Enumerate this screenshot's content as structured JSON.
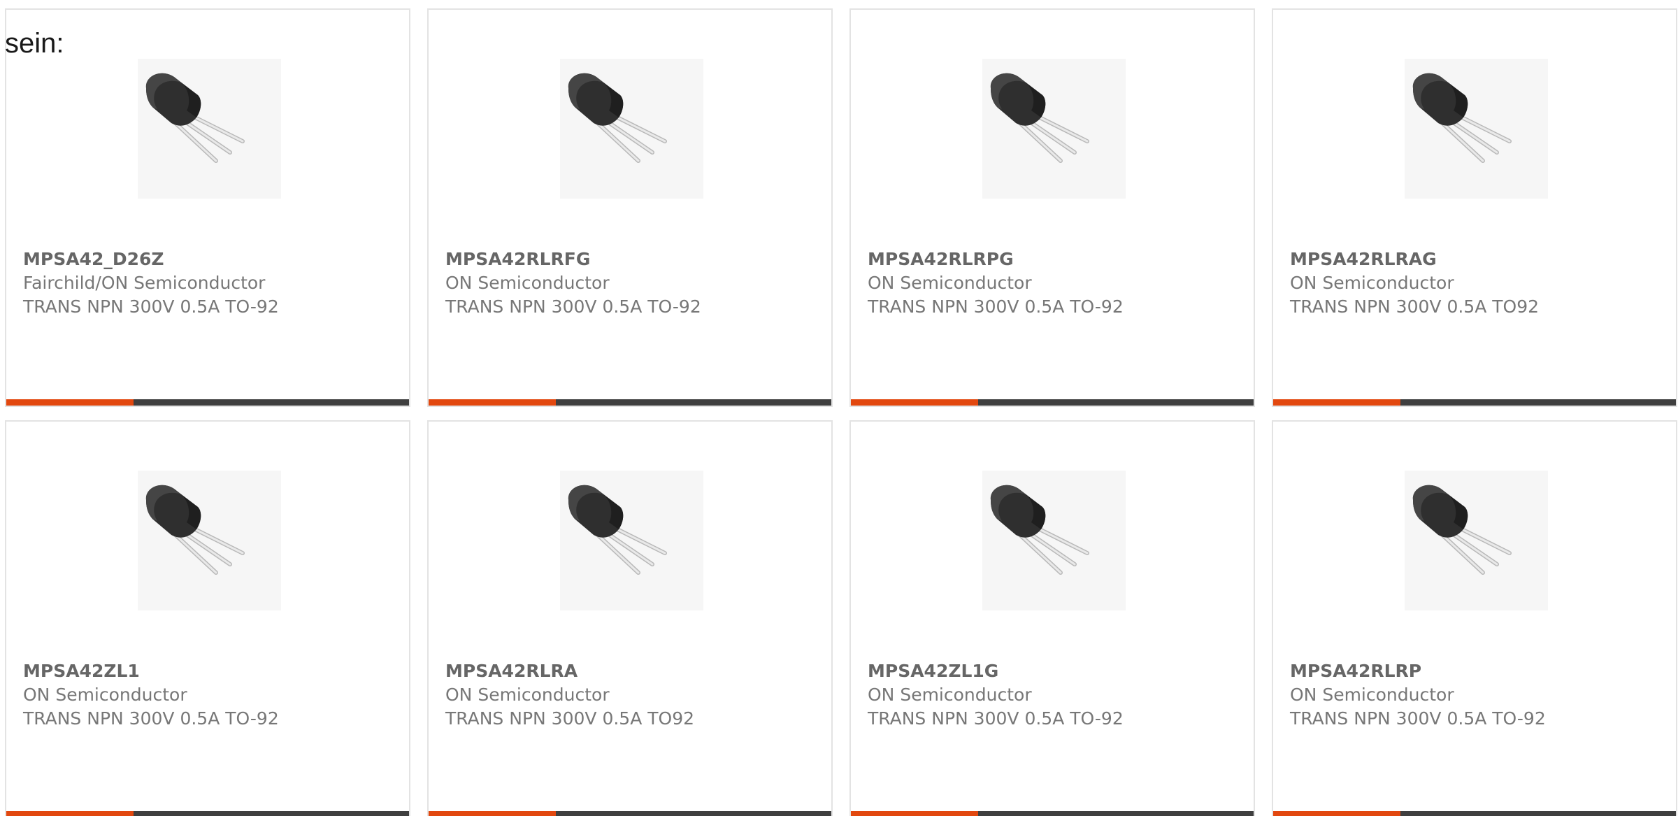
{
  "intro_text": "sein:",
  "colors": {
    "accent_orange": "#e2480f",
    "accent_dark": "#3f3f3f",
    "card_border": "#e3e3e3",
    "text": "#777777"
  },
  "products": [
    {
      "part_number": "MPSA42_D26Z",
      "manufacturer": "Fairchild/ON Semiconductor",
      "description": "TRANS NPN 300V 0.5A TO-92",
      "image_icon": "to92-transistor-icon"
    },
    {
      "part_number": "MPSA42RLRFG",
      "manufacturer": "ON Semiconductor",
      "description": "TRANS NPN 300V 0.5A TO-92",
      "image_icon": "to92-transistor-icon"
    },
    {
      "part_number": "MPSA42RLRPG",
      "manufacturer": "ON Semiconductor",
      "description": "TRANS NPN 300V 0.5A TO-92",
      "image_icon": "to92-transistor-icon"
    },
    {
      "part_number": "MPSA42RLRAG",
      "manufacturer": "ON Semiconductor",
      "description": "TRANS NPN 300V 0.5A TO92",
      "image_icon": "to92-transistor-icon"
    },
    {
      "part_number": "MPSA42ZL1",
      "manufacturer": "ON Semiconductor",
      "description": "TRANS NPN 300V 0.5A TO-92",
      "image_icon": "to92-transistor-icon"
    },
    {
      "part_number": "MPSA42RLRA",
      "manufacturer": "ON Semiconductor",
      "description": "TRANS NPN 300V 0.5A TO92",
      "image_icon": "to92-transistor-icon"
    },
    {
      "part_number": "MPSA42ZL1G",
      "manufacturer": "ON Semiconductor",
      "description": "TRANS NPN 300V 0.5A TO-92",
      "image_icon": "to92-transistor-icon"
    },
    {
      "part_number": "MPSA42RLRP",
      "manufacturer": "ON Semiconductor",
      "description": "TRANS NPN 300V 0.5A TO-92",
      "image_icon": "to92-transistor-icon"
    }
  ]
}
